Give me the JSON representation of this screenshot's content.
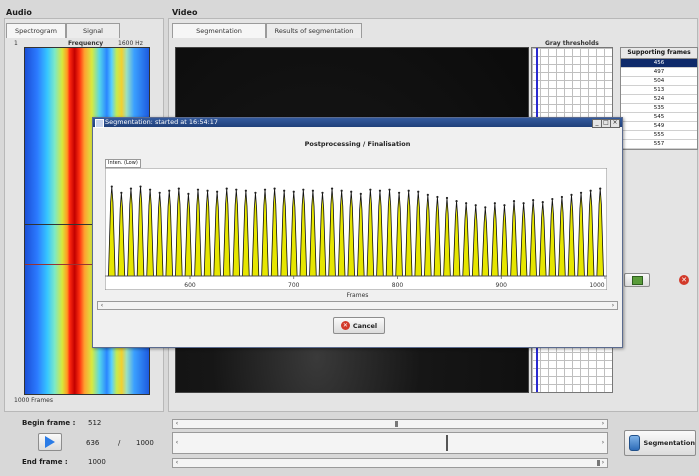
{
  "audio": {
    "section_title": "Audio",
    "tabs": [
      {
        "label": "Spectrogram"
      },
      {
        "label": "Signal"
      }
    ],
    "spec_header": {
      "left": "1",
      "center": "Frequency",
      "right": "1600 Hz"
    },
    "frames_label": "1000 Frames"
  },
  "video": {
    "section_title": "Video",
    "tabs": [
      {
        "label": "Segmentation"
      },
      {
        "label": "Results of segmentation"
      }
    ],
    "thresholds_title": "Gray thresholds"
  },
  "supporting_frames": {
    "title": "Supporting frames",
    "rows": [
      "456",
      "497",
      "504",
      "513",
      "524",
      "535",
      "545",
      "549",
      "555",
      "557"
    ],
    "selected_index": 0
  },
  "dialog": {
    "title": "Segmentation: started at 16:54:17",
    "subtitle": "Postprocessing / Finalisation",
    "legend_label": "Inten. (Low)",
    "cancel_label": "Cancel",
    "chart_data": {
      "type": "line",
      "x_ticks": [
        "600",
        "700",
        "800",
        "900",
        "1000"
      ],
      "xlabel": "Frames",
      "xlim": [
        520,
        1000
      ],
      "series_color": "#e6e600",
      "values": [
        0.86,
        0.8,
        0.84,
        0.86,
        0.83,
        0.8,
        0.82,
        0.84,
        0.79,
        0.83,
        0.82,
        0.81,
        0.84,
        0.83,
        0.82,
        0.8,
        0.83,
        0.84,
        0.82,
        0.81,
        0.83,
        0.82,
        0.8,
        0.84,
        0.82,
        0.81,
        0.79,
        0.83,
        0.82,
        0.83,
        0.8,
        0.82,
        0.81,
        0.78,
        0.76,
        0.75,
        0.72,
        0.7,
        0.68,
        0.66,
        0.7,
        0.68,
        0.72,
        0.7,
        0.73,
        0.71,
        0.74,
        0.76,
        0.78,
        0.8,
        0.82,
        0.84
      ]
    }
  },
  "controls": {
    "begin_label": "Begin frame :",
    "begin_value": "512",
    "current_value": "636",
    "separator": "/",
    "total_value": "1000",
    "end_label": "End frame :",
    "end_value": "1000",
    "segmentation_label": "Segmentation",
    "begin_slider_fraction": 0.512,
    "current_slider_fraction": 0.636,
    "end_slider_fraction": 1.0
  }
}
